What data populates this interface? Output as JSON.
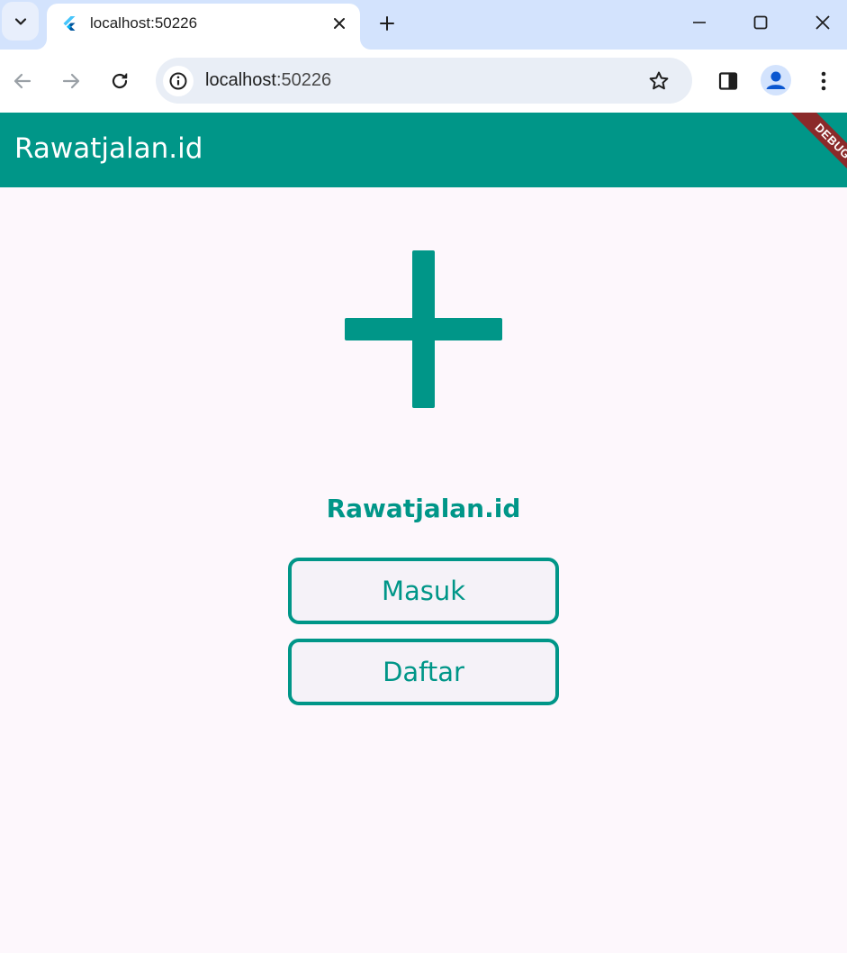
{
  "browser": {
    "tab": {
      "title": "localhost:50226"
    },
    "address": {
      "host": "localhost",
      "port": ":50226"
    }
  },
  "app": {
    "appbar_title": "Rawatjalan.id",
    "debug_label": "DEBUG",
    "brand": "Rawatjalan.id",
    "login_label": "Masuk",
    "register_label": "Daftar"
  },
  "colors": {
    "primary": "#009688",
    "tabstrip": "#d3e3fd",
    "page_background": "#fdf7fc",
    "button_fill": "#f5f2f8",
    "debug_banner": "#8b2a2a"
  },
  "icons": [
    "chevron-down-icon",
    "flutter-icon",
    "close-icon",
    "plus-icon",
    "minimize-icon",
    "maximize-icon",
    "window-close-icon",
    "back-arrow-icon",
    "forward-arrow-icon",
    "reload-icon",
    "info-icon",
    "star-icon",
    "side-panel-icon",
    "profile-icon",
    "more-vert-icon",
    "medical-cross-icon"
  ]
}
